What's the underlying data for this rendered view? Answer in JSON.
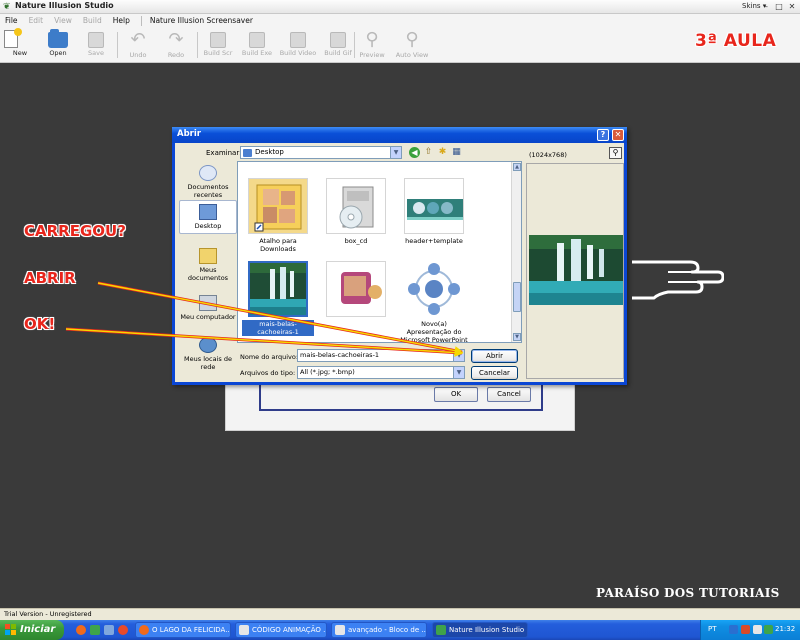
{
  "app": {
    "title": "Nature Illusion Studio",
    "skins": "Skins ▾"
  },
  "menubar": {
    "file": "File",
    "edit": "Edit",
    "view": "View",
    "build": "Build",
    "help": "Help",
    "screensaver": "Nature Illusion Screensaver"
  },
  "toolbar": {
    "new": "New",
    "open": "Open",
    "save": "Save",
    "undo": "Undo",
    "redo": "Redo",
    "build_scr": "Build Scr",
    "build_exe": "Build Exe",
    "build_video": "Build Video",
    "build_gif": "Build Gif",
    "preview": "Preview",
    "auto_view": "Auto View"
  },
  "aula_badge": "3ª AULA",
  "annotations": {
    "carregou": "CARREGOU?",
    "abrir": "ABRIR",
    "ok": "OK!"
  },
  "bg_panel": {
    "ok": "OK",
    "cancel": "Cancel"
  },
  "dialog": {
    "title": "Abrir",
    "look_in_label": "Examinar:",
    "look_in_value": "Desktop",
    "preview_size": "(1024x768)",
    "places": [
      {
        "label": "Documentos recentes"
      },
      {
        "label": "Desktop"
      },
      {
        "label": "Meus documentos"
      },
      {
        "label": "Meu computador"
      },
      {
        "label": "Meus locais de rede"
      }
    ],
    "files": [
      {
        "name": "Atalho para Downloads"
      },
      {
        "name": "box_cd"
      },
      {
        "name": "header+template"
      },
      {
        "name": "mais-belas-cachoeiras-1"
      },
      {
        "name": ""
      },
      {
        "name": "Novo(a) Apresentação do Microsoft PowerPoint"
      }
    ],
    "filename_label": "Nome do arquivo:",
    "filename_value": "mais-belas-cachoeiras-1",
    "filetype_label": "Arquivos do tipo:",
    "filetype_value": "All (*.jpg; *.bmp)",
    "open_button": "Abrir",
    "cancel_button": "Cancelar"
  },
  "footer_tag": "PARAÍSO DOS TUTORIAIS",
  "statusbar": "Trial Version - Unregistered",
  "taskbar": {
    "start": "Iniciar",
    "tasks": [
      {
        "label": "O LAGO DA FELICIDA..."
      },
      {
        "label": "CÓDIGO ANIMAÇÃO ..."
      },
      {
        "label": "avançado - Bloco de ..."
      },
      {
        "label": "Nature Illusion Studio"
      }
    ],
    "lang": "PT",
    "clock": "21:32"
  }
}
